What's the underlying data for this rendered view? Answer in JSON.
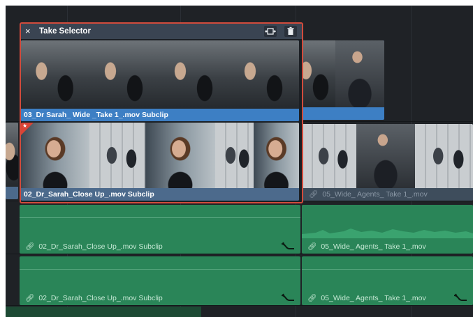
{
  "take_selector": {
    "close_glyph": "×",
    "title": "Take Selector",
    "buttons": [
      {
        "name": "fit-clip-icon"
      },
      {
        "name": "trash-icon"
      }
    ],
    "takes": [
      {
        "label": "03_Dr Sarah_ Wide _Take 1_.mov Subclip",
        "selected": true
      },
      {
        "label": "02_Dr_Sarah_Close Up_.mov Subclip",
        "selected": false,
        "flagged": true
      }
    ]
  },
  "video_track": {
    "clips": [
      {
        "label": "05_Wide_ Agents_ Take 1_.mov",
        "linked": true
      }
    ]
  },
  "audio_tracks": [
    {
      "clips": [
        {
          "label": "02_Dr_Sarah_Close Up_.mov Subclip",
          "linked": true,
          "curve_icon": true
        },
        {
          "label": "05_Wide_ Agents_ Take 1_.mov",
          "linked": true,
          "curve_icon": false
        }
      ]
    },
    {
      "clips": [
        {
          "label": "02_Dr_Sarah_Close Up_.mov Subclip",
          "linked": true,
          "curve_icon": true
        },
        {
          "label": "05_Wide_ Agents_ Take 1_.mov",
          "linked": true,
          "curve_icon": true
        }
      ]
    }
  ],
  "colors": {
    "take_selector_border": "#d24b3c",
    "selected_take_label": "#3d7fc4",
    "audio_clip": "#2a8558",
    "flag": "#d94436"
  }
}
